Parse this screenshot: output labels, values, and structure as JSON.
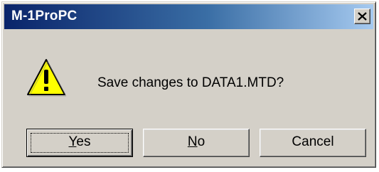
{
  "window": {
    "title": "M-1ProPC"
  },
  "dialog": {
    "message": "Save changes to DATA1.MTD?",
    "icon": "warning-icon"
  },
  "buttons": {
    "yes": {
      "mnemonic": "Y",
      "rest": "es"
    },
    "no": {
      "mnemonic": "N",
      "rest": "o"
    },
    "cancel": {
      "label": "Cancel"
    }
  },
  "colors": {
    "titlebar_start": "#0a246a",
    "titlebar_end": "#a6caf0",
    "face": "#d4d0c8",
    "warning_yellow": "#ffff00"
  }
}
